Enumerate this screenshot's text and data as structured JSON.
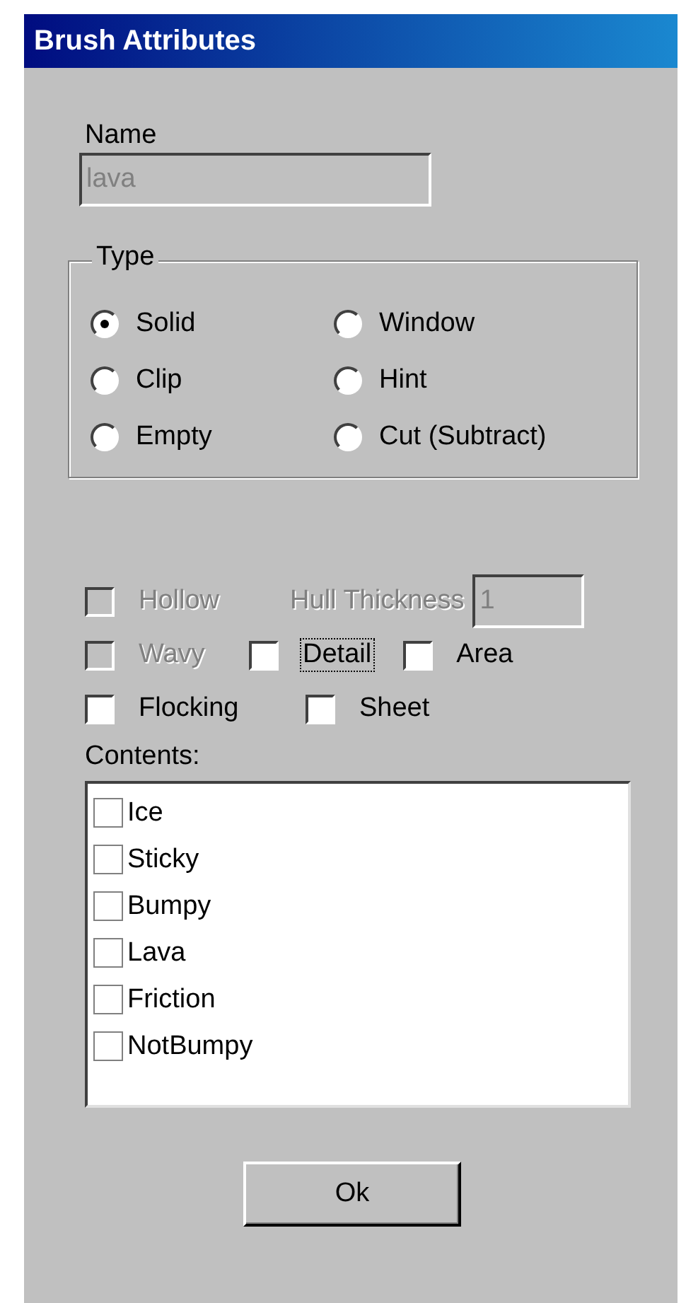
{
  "window": {
    "title": "Brush Attributes"
  },
  "name_field": {
    "label": "Name",
    "value": "lava",
    "disabled": true
  },
  "type_group": {
    "label": "Type",
    "options": [
      {
        "label": "Solid",
        "selected": true
      },
      {
        "label": "Window",
        "selected": false
      },
      {
        "label": "Clip",
        "selected": false
      },
      {
        "label": "Hint",
        "selected": false
      },
      {
        "label": "Empty",
        "selected": false
      },
      {
        "label": "Cut (Subtract)",
        "selected": false
      }
    ]
  },
  "hollow": {
    "label": "Hollow",
    "checked": false,
    "disabled": true
  },
  "hull_thickness": {
    "label": "Hull Thickness",
    "value": "1",
    "disabled": true
  },
  "flag_rows": [
    [
      {
        "label": "Wavy",
        "checked": false,
        "disabled": true,
        "focused": false
      },
      {
        "label": "Detail",
        "checked": false,
        "disabled": false,
        "focused": true
      },
      {
        "label": "Area",
        "checked": false,
        "disabled": false,
        "focused": false
      }
    ],
    [
      {
        "label": "Flocking",
        "checked": false,
        "disabled": false,
        "focused": false
      },
      {
        "label": "Sheet",
        "checked": false,
        "disabled": false,
        "focused": false
      }
    ]
  ],
  "contents": {
    "label": "Contents:",
    "items": [
      {
        "label": "Ice",
        "checked": false
      },
      {
        "label": "Sticky",
        "checked": false
      },
      {
        "label": "Bumpy",
        "checked": false
      },
      {
        "label": "Lava",
        "checked": false
      },
      {
        "label": "Friction",
        "checked": false
      },
      {
        "label": "NotBumpy",
        "checked": false
      }
    ]
  },
  "ok_button": {
    "label": "Ok"
  }
}
